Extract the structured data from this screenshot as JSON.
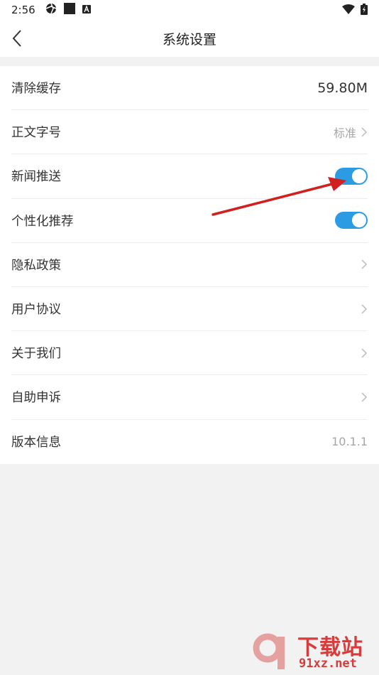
{
  "status_bar": {
    "time": "2:56"
  },
  "nav": {
    "title": "系统设置"
  },
  "settings": [
    {
      "label": "清除缓存",
      "value": "59.80M",
      "kind": "value-big"
    },
    {
      "label": "正文字号",
      "value": "标准",
      "kind": "value-chevron"
    },
    {
      "label": "新闻推送",
      "kind": "toggle",
      "on": true
    },
    {
      "label": "个性化推荐",
      "kind": "toggle",
      "on": true
    },
    {
      "label": "隐私政策",
      "kind": "chevron"
    },
    {
      "label": "用户协议",
      "kind": "chevron"
    },
    {
      "label": "关于我们",
      "kind": "chevron"
    },
    {
      "label": "自助申诉",
      "kind": "chevron"
    },
    {
      "label": "版本信息",
      "value": "10.1.1",
      "kind": "value"
    }
  ],
  "watermark": {
    "brand": "下载站",
    "url": "91xz.net"
  },
  "colors": {
    "toggle_on": "#2b9be3",
    "annotation_arrow": "#d0201f",
    "watermark": "#d93a3a"
  }
}
